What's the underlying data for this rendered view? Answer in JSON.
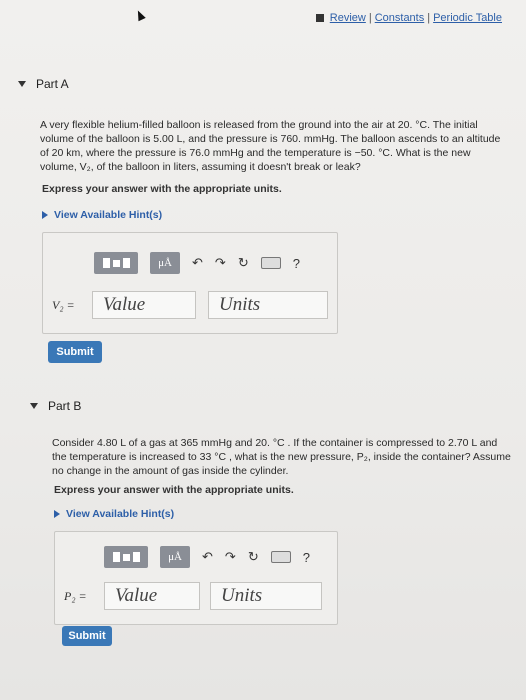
{
  "header": {
    "review": "Review",
    "constants": "Constants",
    "periodic_table": "Periodic Table",
    "sep": "|"
  },
  "part_a": {
    "title": "Part A",
    "problem": "A very flexible helium-filled balloon is released from the ground into the air at 20. °C. The initial volume of the balloon is 5.00 L, and the pressure is 760. mmHg. The balloon ascends to an altitude of 20 km, where the pressure is 76.0 mmHg and the temperature is −50. °C. What is the new volume, V₂, of the balloon in liters, assuming it doesn't break or leak?",
    "express": "Express your answer with the appropriate units.",
    "hints": "View Available Hint(s)",
    "var_label": "V₂ =",
    "value_placeholder": "Value",
    "units_placeholder": "Units",
    "submit": "Submit"
  },
  "part_b": {
    "title": "Part B",
    "problem": "Consider 4.80 L of a gas at 365 mmHg and 20. °C . If the container is compressed to 2.70 L and the temperature is increased to 33 °C , what is the new pressure, P₂, inside the container? Assume no change in the amount of gas inside the cylinder.",
    "express": "Express your answer with the appropriate units.",
    "hints": "View Available Hint(s)",
    "var_label": "P₂ =",
    "value_placeholder": "Value",
    "units_placeholder": "Units",
    "submit": "Submit"
  },
  "toolbar": {
    "mu_label": "μÅ",
    "undo": "↶",
    "redo": "↷",
    "reset": "↻",
    "help": "?"
  }
}
